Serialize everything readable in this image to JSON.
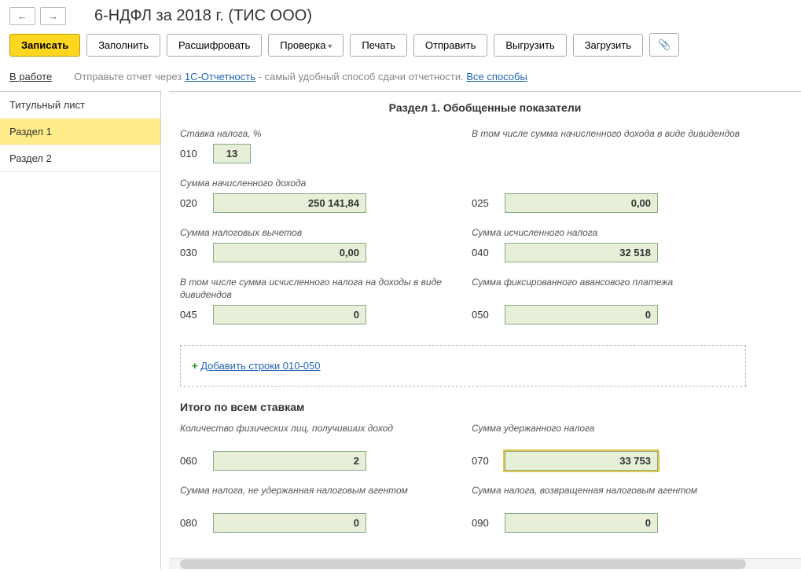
{
  "nav": {
    "back": "←",
    "fwd": "→"
  },
  "title": "6-НДФЛ за 2018 г. (ТИС ООО)",
  "toolbar": {
    "save": "Записать",
    "fill": "Заполнить",
    "decode": "Расшифровать",
    "check": "Проверка",
    "print": "Печать",
    "send": "Отправить",
    "export": "Выгрузить",
    "import": "Загрузить"
  },
  "info": {
    "status": "В работе",
    "text1": "Отправьте отчет через ",
    "link1": "1С-Отчетность",
    "text2": " - самый удобный способ сдачи отчетности. ",
    "link2": "Все способы"
  },
  "sidebar": {
    "items": [
      {
        "label": "Титульный лист"
      },
      {
        "label": "Раздел 1"
      },
      {
        "label": "Раздел 2"
      }
    ]
  },
  "section": {
    "title": "Раздел 1. Обобщенные показатели",
    "rate_label": "Ставка налога, %",
    "f010": "13",
    "lbl_div": "В том числе сумма начисленного дохода в виде дивидендов",
    "lbl_income": "Сумма начисленного дохода",
    "f020": "250 141,84",
    "f025": "0,00",
    "lbl_deduct": "Сумма налоговых вычетов",
    "lbl_calc": "Сумма исчисленного налога",
    "f030": "0,00",
    "f040": "32 518",
    "lbl_divtax": "В том числе сумма исчисленного налога на доходы в виде дивидендов",
    "lbl_fixed": "Сумма фиксированного авансового платежа",
    "f045": "0",
    "f050": "0",
    "add_link": "Добавить строки 010-050",
    "totals_head": "Итого по всем ставкам",
    "lbl_persons": "Количество физических лиц, получивших доход",
    "lbl_withheld": "Сумма удержанного налога",
    "f060": "2",
    "f070": "33 753",
    "lbl_notwith": "Сумма налога, не удержанная налоговым агентом",
    "lbl_returned": "Сумма налога, возвращенная налоговым агентом",
    "f080": "0",
    "f090": "0",
    "codes": {
      "c010": "010",
      "c020": "020",
      "c025": "025",
      "c030": "030",
      "c040": "040",
      "c045": "045",
      "c050": "050",
      "c060": "060",
      "c070": "070",
      "c080": "080",
      "c090": "090"
    }
  }
}
